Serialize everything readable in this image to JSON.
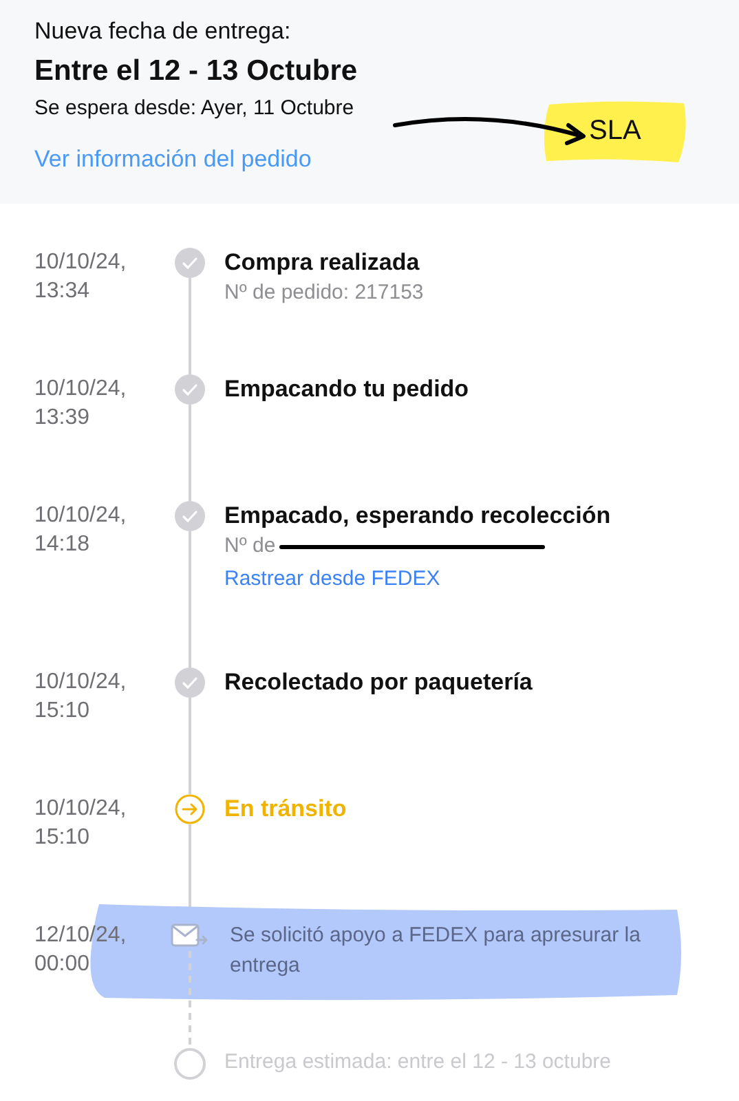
{
  "header": {
    "label": "Nueva fecha de entrega:",
    "date_range": "Entre el 12 - 13 Octubre",
    "expected": "Se espera desde: Ayer, 11 Octubre",
    "link": "Ver información del pedido"
  },
  "sla_annotation": {
    "text": "SLA"
  },
  "timeline": [
    {
      "kind": "done",
      "date": "10/10/24, 13:34",
      "title": "Compra realizada",
      "detail": "Nº de pedido: 217153"
    },
    {
      "kind": "done",
      "date": "10/10/24, 13:39",
      "title": "Empacando tu pedido"
    },
    {
      "kind": "done",
      "date": "10/10/24, 14:18",
      "title": "Empacado, esperando recolección",
      "detail": "Nº de",
      "redacted": true,
      "link": "Rastrear desde FEDEX"
    },
    {
      "kind": "done",
      "date": "10/10/24, 15:10",
      "title": "Recolectado por paquetería"
    },
    {
      "kind": "transit",
      "date": "10/10/24, 15:10",
      "title": "En tránsito"
    },
    {
      "kind": "note",
      "date": "12/10/24, 00:00",
      "title": "Se solicitó apoyo a FEDEX para apresurar la entrega",
      "highlighted": true
    },
    {
      "kind": "pending",
      "title": "Entrega estimada: entre el 12 - 13 octubre"
    }
  ]
}
